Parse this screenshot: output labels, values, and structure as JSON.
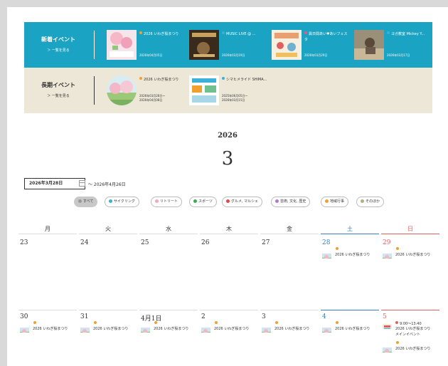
{
  "new_events": {
    "title": "新着イベント",
    "more": "＞ 一覧を見る",
    "cards": [
      {
        "title": "2026 いわぎ桜まつり",
        "date": "2026年04月05日",
        "dot": "#f0a030"
      },
      {
        "title": "MUSIC LIVE @ ...",
        "date": "2026年03月19日",
        "dot": "#3cb0d8"
      },
      {
        "title": "異日間あい♥あいフェスタ",
        "date": "2026年03月29日",
        "dot": "#e8578a"
      },
      {
        "title": "ヨガ教室 Mickey Y...",
        "date": "2026年03月17日",
        "dot": "#3cb0d8"
      }
    ]
  },
  "long_events": {
    "title": "長期イベント",
    "more": "＞ 一覧を見る",
    "cards": [
      {
        "title": "2026 いわぎ桜まつり",
        "date": "2026年03月28日～\n2026年04月08日",
        "dot": "#f0a030"
      },
      {
        "title": "シマヒメライド SHIMA...",
        "date": "2025年06月05日～\n2026年03月15日",
        "dot": "#3cb0d8"
      }
    ]
  },
  "calendar": {
    "year": "2026",
    "month": "3",
    "start_date": "2026年3月28日",
    "end_date": "～ 2026年4月26日",
    "weekdays": [
      "月",
      "火",
      "水",
      "木",
      "金",
      "土",
      "日"
    ],
    "filters": [
      {
        "label": "すべて",
        "color": "#999999",
        "active": true
      },
      {
        "label": "サイクリング",
        "color": "#3cb0d8",
        "active": false
      },
      {
        "label": "リトリート",
        "color": "#f2a8c0",
        "active": false
      },
      {
        "label": "スポーツ",
        "color": "#3daa55",
        "active": false
      },
      {
        "label": "グルメ, マルシェ",
        "color": "#e04848",
        "active": false
      },
      {
        "label": "芸術, 文化, 歴史",
        "color": "#b07ad0",
        "active": false
      },
      {
        "label": "地域行事",
        "color": "#f0a030",
        "active": false
      },
      {
        "label": "そのほか",
        "color": "#b0b080",
        "active": false
      }
    ],
    "week1_days": [
      "23",
      "24",
      "25",
      "26",
      "27",
      "28",
      "29"
    ],
    "week2_days": [
      "30",
      "31",
      "4月1日",
      "2",
      "3",
      "4",
      "5"
    ],
    "event_name": "2026 いわぎ桜まつり",
    "sun5_extra_time": "9:00～13:40",
    "sun5_extra_name": "2026 いわぎ桜まつり",
    "sun5_extra_sub": "メインイベント",
    "colors": {
      "saturday": "#3c7fc0",
      "sunday": "#e06060",
      "event_dot": "#f0a030",
      "teal": "#1aa3c2"
    }
  }
}
